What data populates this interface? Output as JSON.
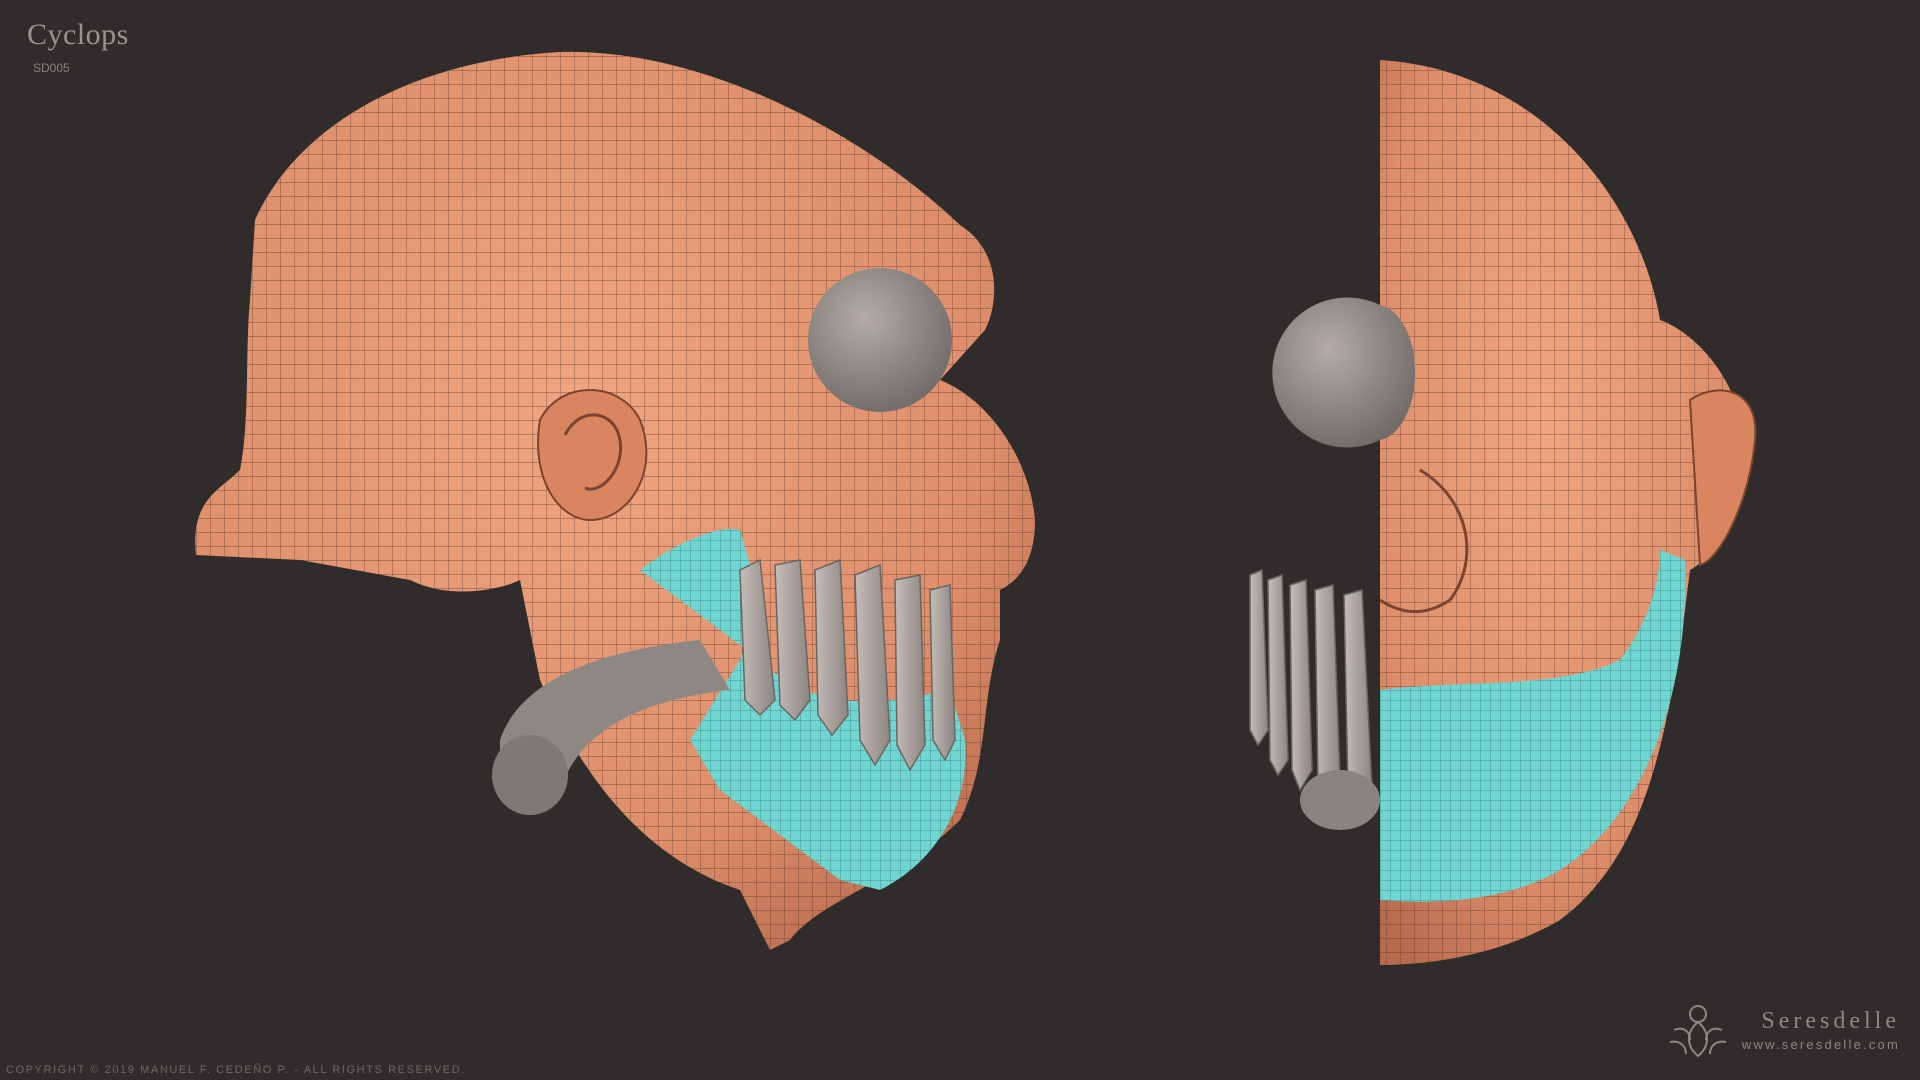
{
  "header": {
    "title": "Cyclops",
    "subtitle": "SD005"
  },
  "footer": {
    "copyright": "COPYRIGHT © 2019 MANUEL F. CEDEÑO P.  -  ALL RIGHTS RESERVED.",
    "brand_name": "Seresdelle",
    "brand_url": "www.seresdelle.com"
  },
  "colors": {
    "background": "#2f2c2b",
    "skin": "#e49673",
    "mask": "#6fd6d2",
    "teeth": "#a9a29d",
    "eye": "#8f8985",
    "wire": "#5a3626"
  },
  "icons": [
    "seresdelle-logo-icon"
  ]
}
